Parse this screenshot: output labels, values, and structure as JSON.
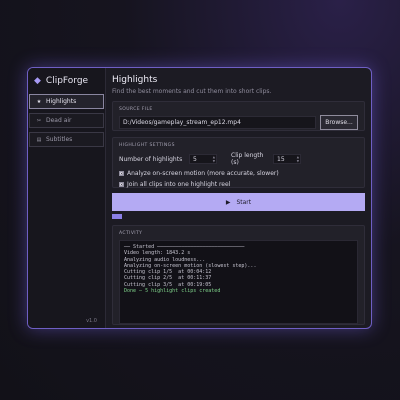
{
  "app": {
    "name": "ClipForge",
    "version": "v1.0"
  },
  "sidebar": {
    "items": [
      {
        "label": "Highlights",
        "icon": "star-icon",
        "glyph": "★",
        "active": true
      },
      {
        "label": "Dead air",
        "icon": "scissors-icon",
        "glyph": "✂",
        "active": false
      },
      {
        "label": "Subtitles",
        "icon": "subtitles-icon",
        "glyph": "▤",
        "active": false
      }
    ]
  },
  "main": {
    "title": "Highlights",
    "subtitle": "Find the best moments and cut them into short clips."
  },
  "source": {
    "heading": "SOURCE FILE",
    "path": "D:/Videos/gameplay_stream_ep12.mp4",
    "browse_label": "Browse..."
  },
  "settings": {
    "heading": "HIGHLIGHT SETTINGS",
    "num_label": "Number of highlights",
    "num_value": "5",
    "length_label": "Clip length (s)",
    "length_value": "15",
    "motion_label": "Analyze on-screen motion (more accurate, slower)",
    "motion_checked": true,
    "join_label": "Join all clips into one highlight reel",
    "join_checked": true
  },
  "start": {
    "label": "Start",
    "glyph": "▶"
  },
  "progress": {
    "fraction": 0.04
  },
  "activity": {
    "heading": "ACTIVITY",
    "lines": [
      "── Started ─────────────────────────────",
      "Video length: 1843.2 s",
      "Analyzing audio loudness...",
      "Analyzing on-screen motion (slowest step)...",
      "Cutting clip 1/5  at 00:04:12",
      "Cutting clip 2/5  at 00:11:37",
      "Cutting clip 3/5  at 00:19:05"
    ],
    "done_line": "Done — 5 highlight clips created"
  },
  "colors": {
    "accent": "#b4aaf3",
    "border": "#6f5fc4",
    "success": "#7fd38a"
  }
}
